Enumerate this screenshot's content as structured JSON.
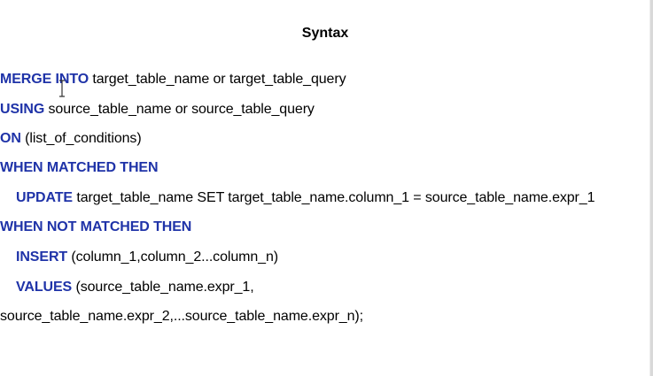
{
  "title": "Syntax",
  "lines": [
    {
      "keyword": "MERGE INTO",
      "text": " target_table_name or target_table_query"
    },
    {
      "keyword": "USING",
      "text": " source_table_name or source_table_query"
    },
    {
      "keyword": "ON",
      "text": " (list_of_conditions)"
    },
    {
      "keyword": "WHEN MATCHED THEN",
      "text": ""
    },
    {
      "keyword": "UPDATE",
      "text": " target_table_name SET target_table_name.column_1 = source_table_name.expr_1"
    },
    {
      "keyword": "WHEN NOT MATCHED THEN",
      "text": ""
    },
    {
      "keyword": "INSERT",
      "text": " (column_1,column_2...column_n)"
    },
    {
      "keyword": "VALUES",
      "text": " (source_table_name.expr_1,"
    },
    {
      "keyword": "",
      "text": "source_table_name.expr_2,...source_table_name.expr_n);"
    }
  ],
  "colors": {
    "keyword": "#1f33a8",
    "text": "#000000",
    "background": "#ffffff"
  },
  "icons": {
    "cursor": "text-cursor-icon"
  }
}
